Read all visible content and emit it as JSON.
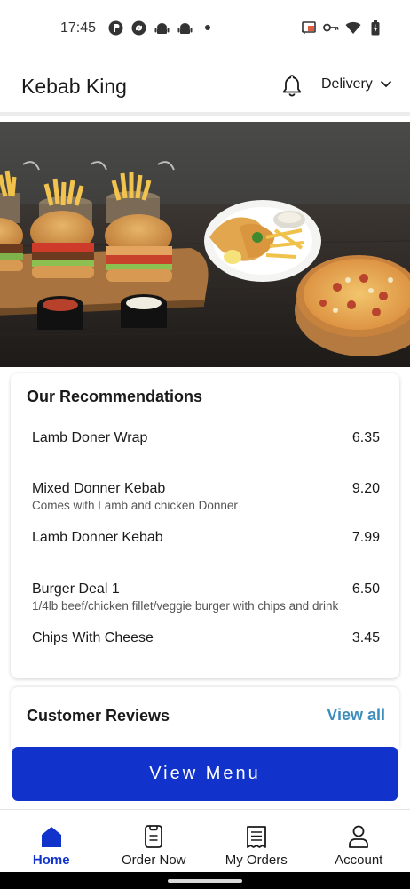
{
  "status_bar": {
    "time": "17:45",
    "left_icons": [
      "app-notification-icon",
      "sync-icon",
      "android-icon",
      "android-icon",
      "dot-icon"
    ],
    "right_icons": [
      "cast-icon",
      "key-icon",
      "wifi-icon",
      "battery-icon"
    ]
  },
  "header": {
    "title": "Kebab King",
    "bell_icon": "bell-icon",
    "delivery_label": "Delivery",
    "dropdown_icon": "chevron-down-icon"
  },
  "hero": {
    "image": "food-banner-image"
  },
  "recommendations": {
    "title": "Our Recommendations",
    "items": [
      {
        "name": "Lamb Doner Wrap",
        "price": "6.35",
        "description": ""
      },
      {
        "name": "Mixed Donner Kebab",
        "price": "9.20",
        "description": "Comes with Lamb and chicken Donner"
      },
      {
        "name": "Lamb Donner Kebab",
        "price": "7.99",
        "description": ""
      },
      {
        "name": "Burger Deal 1",
        "price": "6.50",
        "description": "1/4lb beef/chicken fillet/veggie burger with chips and drink"
      },
      {
        "name": "Chips With Cheese",
        "price": "3.45",
        "description": ""
      }
    ]
  },
  "reviews": {
    "title": "Customer Reviews",
    "view_all": "View all"
  },
  "view_menu_button": "View Menu",
  "bottom_nav": {
    "items": [
      {
        "label": "Home",
        "icon": "home-icon",
        "active": true
      },
      {
        "label": "Order Now",
        "icon": "order-icon",
        "active": false
      },
      {
        "label": "My Orders",
        "icon": "receipt-icon",
        "active": false
      },
      {
        "label": "Account",
        "icon": "person-icon",
        "active": false
      }
    ]
  },
  "colors": {
    "primary": "#1133cc",
    "link": "#3c8dbc"
  }
}
